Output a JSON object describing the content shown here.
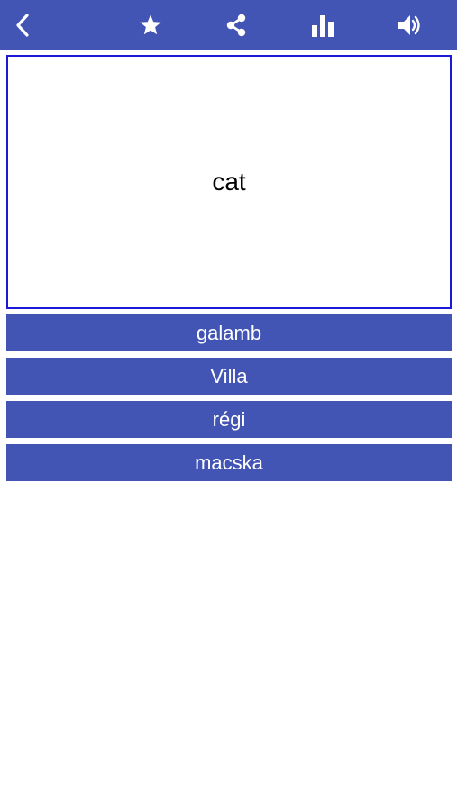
{
  "colors": {
    "accent": "#4255b4",
    "card_border": "#1a1ad6",
    "background": "#ffffff",
    "answer_text": "#ffffff"
  },
  "toolbar": {
    "icons": [
      "back-chevron-icon",
      "star-icon",
      "share-icon",
      "bar-chart-icon",
      "speaker-icon"
    ]
  },
  "card": {
    "word": "cat"
  },
  "answers": [
    {
      "label": "galamb"
    },
    {
      "label": "Villa"
    },
    {
      "label": "régi"
    },
    {
      "label": "macska"
    }
  ]
}
